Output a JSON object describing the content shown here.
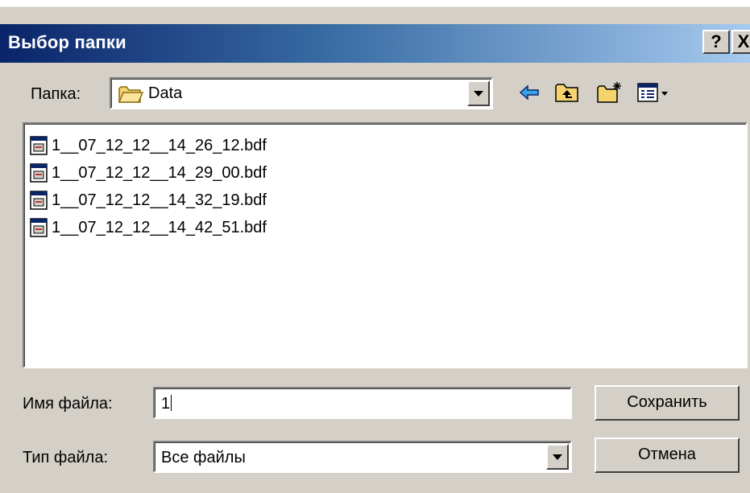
{
  "window": {
    "title": "Выбор папки",
    "help_label": "?",
    "close_label": "X"
  },
  "folder": {
    "label": "Папка:",
    "value": "Data",
    "icon": "folder-icon"
  },
  "toolbar": {
    "icons": [
      "back-arrow-icon",
      "up-one-level-icon",
      "new-folder-icon",
      "view-menu-icon"
    ]
  },
  "files": [
    {
      "name": "1__07_12_12__14_26_12.bdf",
      "icon": "bdf-file-icon"
    },
    {
      "name": "1__07_12_12__14_29_00.bdf",
      "icon": "bdf-file-icon"
    },
    {
      "name": "1__07_12_12__14_32_19.bdf",
      "icon": "bdf-file-icon"
    },
    {
      "name": "1__07_12_12__14_42_51.bdf",
      "icon": "bdf-file-icon"
    }
  ],
  "filename": {
    "label": "Имя файла:",
    "value": "1"
  },
  "filetype": {
    "label": "Тип файла:",
    "value": "Все файлы"
  },
  "buttons": {
    "save": "Сохранить",
    "cancel": "Отмена"
  },
  "colors": {
    "titlebar_start": "#0a246a",
    "titlebar_end": "#a6caf0",
    "dialog_bg": "#d4d0c8"
  }
}
